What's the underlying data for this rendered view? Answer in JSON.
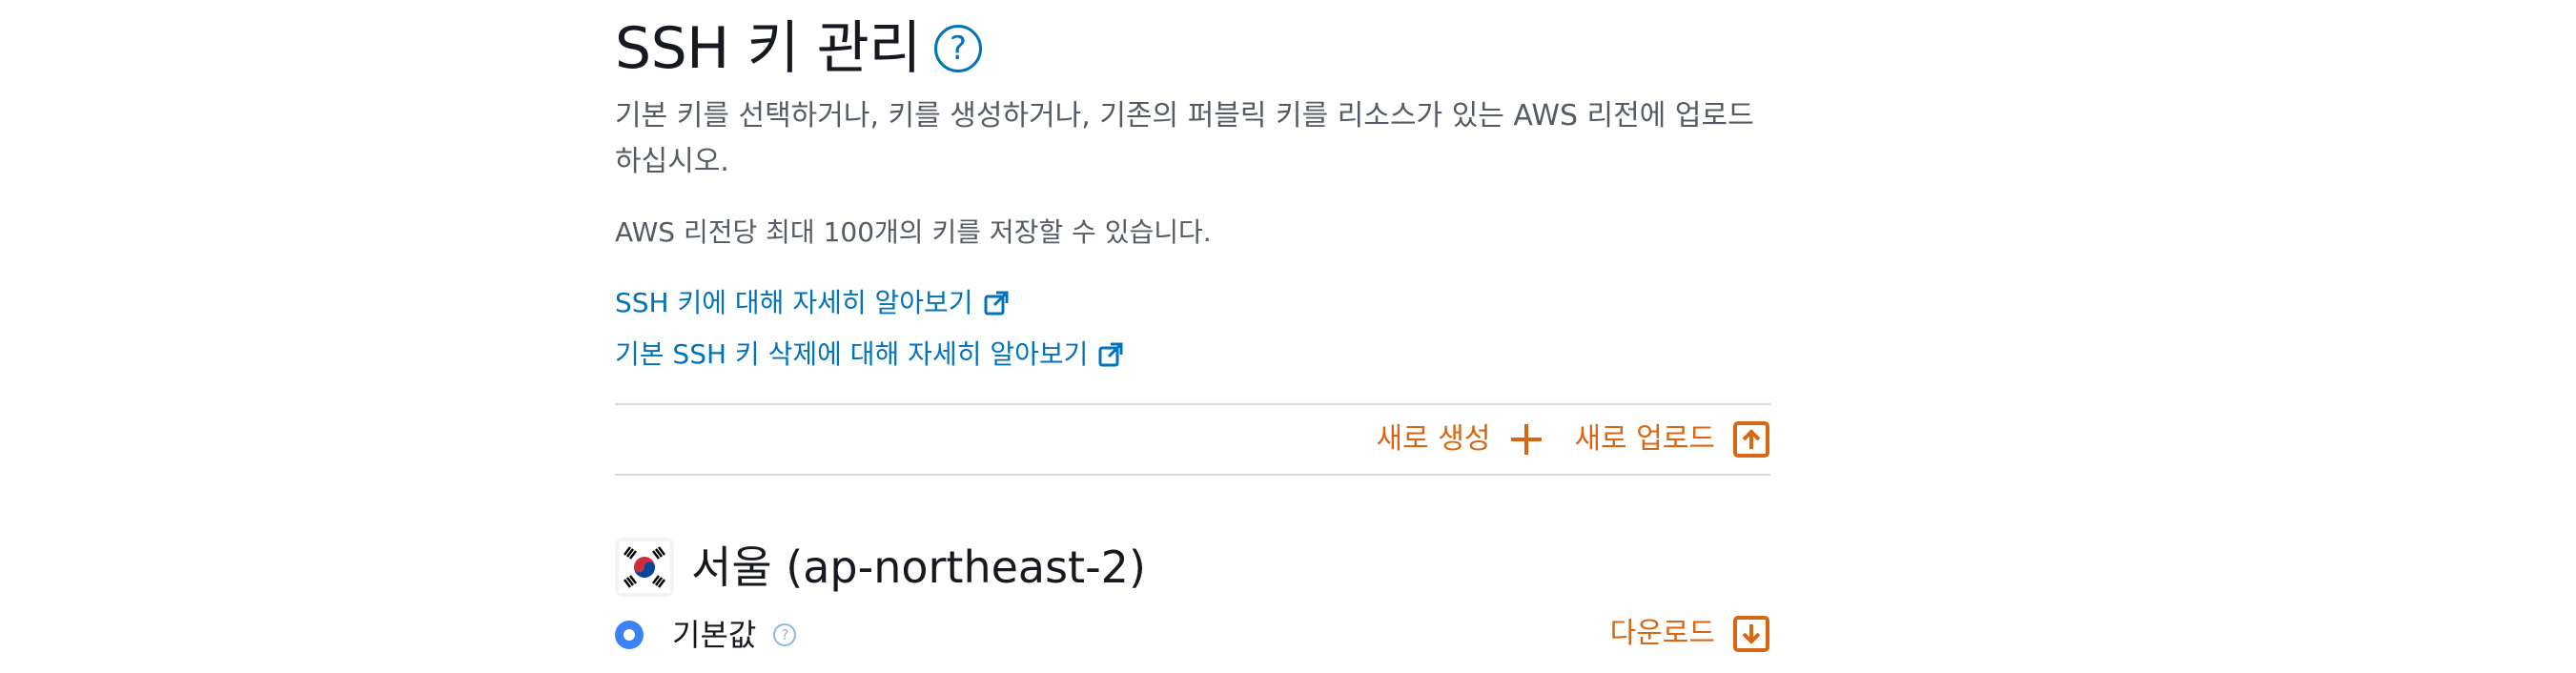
{
  "header": {
    "title": "SSH 키 관리",
    "help_icon": "question-circle-icon"
  },
  "description": "기본 키를 선택하거나, 키를 생성하거나, 기존의 퍼블릭 키를 리소스가 있는 AWS 리전에 업로드하십시오.",
  "limit_text": "AWS 리전당 최대 100개의 키를 저장할 수 있습니다.",
  "links": [
    {
      "label": "SSH 키에 대해 자세히 알아보기",
      "icon": "external-link-icon"
    },
    {
      "label": "기본 SSH 키 삭제에 대해 자세히 알아보기",
      "icon": "external-link-icon"
    }
  ],
  "actions": {
    "create_label": "새로 생성",
    "create_icon": "plus-icon",
    "upload_label": "새로 업로드",
    "upload_icon": "upload-icon"
  },
  "region": {
    "flag_icon": "south-korea-flag-icon",
    "name": "서울 (ap-northeast-2)"
  },
  "default_key": {
    "label": "기본값",
    "selected": true,
    "download_label": "다운로드",
    "download_icon": "download-icon"
  },
  "colors": {
    "link": "#0073bb",
    "action": "#d86613",
    "radio": "#3b82f6",
    "divider": "#d5dbdb"
  }
}
